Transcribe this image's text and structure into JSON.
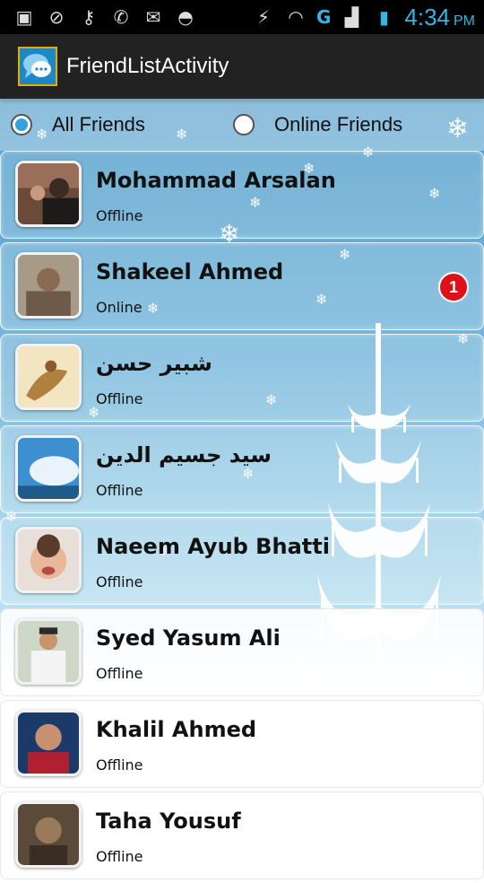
{
  "status_bar": {
    "time": "4:34",
    "ampm": "PM",
    "network": "G",
    "left_icons": [
      "notification-icon",
      "settings-icon",
      "key-icon",
      "whatsapp-icon",
      "gmail-icon",
      "android-icon"
    ],
    "right_icons": [
      "battery-saver-icon",
      "wifi-icon",
      "signal-icon",
      "battery-icon"
    ]
  },
  "action_bar": {
    "title": "FriendListActivity",
    "icon": "chat-bubble-icon"
  },
  "filter": {
    "options": [
      {
        "label": "All Friends",
        "selected": true
      },
      {
        "label": "Online Friends",
        "selected": false
      }
    ]
  },
  "friends": [
    {
      "name": "Mohammad Arsalan",
      "status": "Offline"
    },
    {
      "name": "Shakeel Ahmed",
      "status": "Online",
      "badge": "1"
    },
    {
      "name": "شبیر حسن",
      "status": "Offline"
    },
    {
      "name": "سید جسیم الدین",
      "status": "Offline"
    },
    {
      "name": "Naeem Ayub Bhatti",
      "status": "Offline"
    },
    {
      "name": "Syed Yasum Ali",
      "status": "Offline"
    },
    {
      "name": "Khalil Ahmed",
      "status": "Offline"
    },
    {
      "name": "Taha Yousuf",
      "status": "Offline"
    }
  ],
  "colors": {
    "accent": "#33b5e5",
    "badge": "#e0101a",
    "sky_top": "#4f9cc9",
    "sky_bottom": "#bfe3f2"
  }
}
